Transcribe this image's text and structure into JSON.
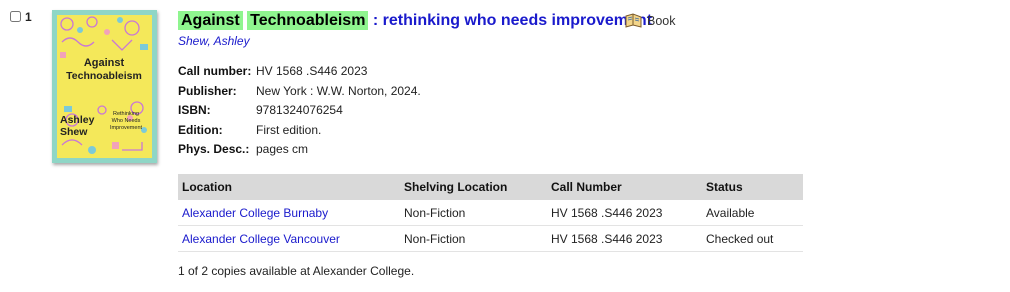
{
  "result": {
    "number": "1",
    "title_words_highlighted": [
      "Against",
      "Technoableism"
    ],
    "subtitle": ": rethinking who needs improvement",
    "format": "Book",
    "author": "Shew, Ashley"
  },
  "cover": {
    "title_line1": "Against",
    "title_line2": "Technoableism",
    "subtitle_lines": [
      "Rethinking",
      "Who Needs",
      "Improvement"
    ],
    "author_line1": "Ashley",
    "author_line2": "Shew",
    "background_color": "#f4e85a",
    "border_color": "#8fd6c6"
  },
  "details": [
    {
      "label": "Call number:",
      "value": "HV 1568 .S446 2023"
    },
    {
      "label": "Publisher:",
      "value": "New York : W.W. Norton, 2024."
    },
    {
      "label": "ISBN:",
      "value": "9781324076254"
    },
    {
      "label": "Edition:",
      "value": "First edition."
    },
    {
      "label": "Phys. Desc.:",
      "value": "pages cm"
    }
  ],
  "holdings": {
    "headers": [
      "Location",
      "Shelving Location",
      "Call Number",
      "Status"
    ],
    "rows": [
      [
        "Alexander College Burnaby",
        "Non-Fiction",
        "HV 1568 .S446 2023",
        "Available"
      ],
      [
        "Alexander College Vancouver",
        "Non-Fiction",
        "HV 1568 .S446 2023",
        "Checked out"
      ]
    ]
  },
  "availability": "1 of 2 copies available at Alexander College.",
  "colors": {
    "link": "#1a1acc",
    "highlight": "#8ff58f",
    "table_header": "#d9d9d9"
  }
}
